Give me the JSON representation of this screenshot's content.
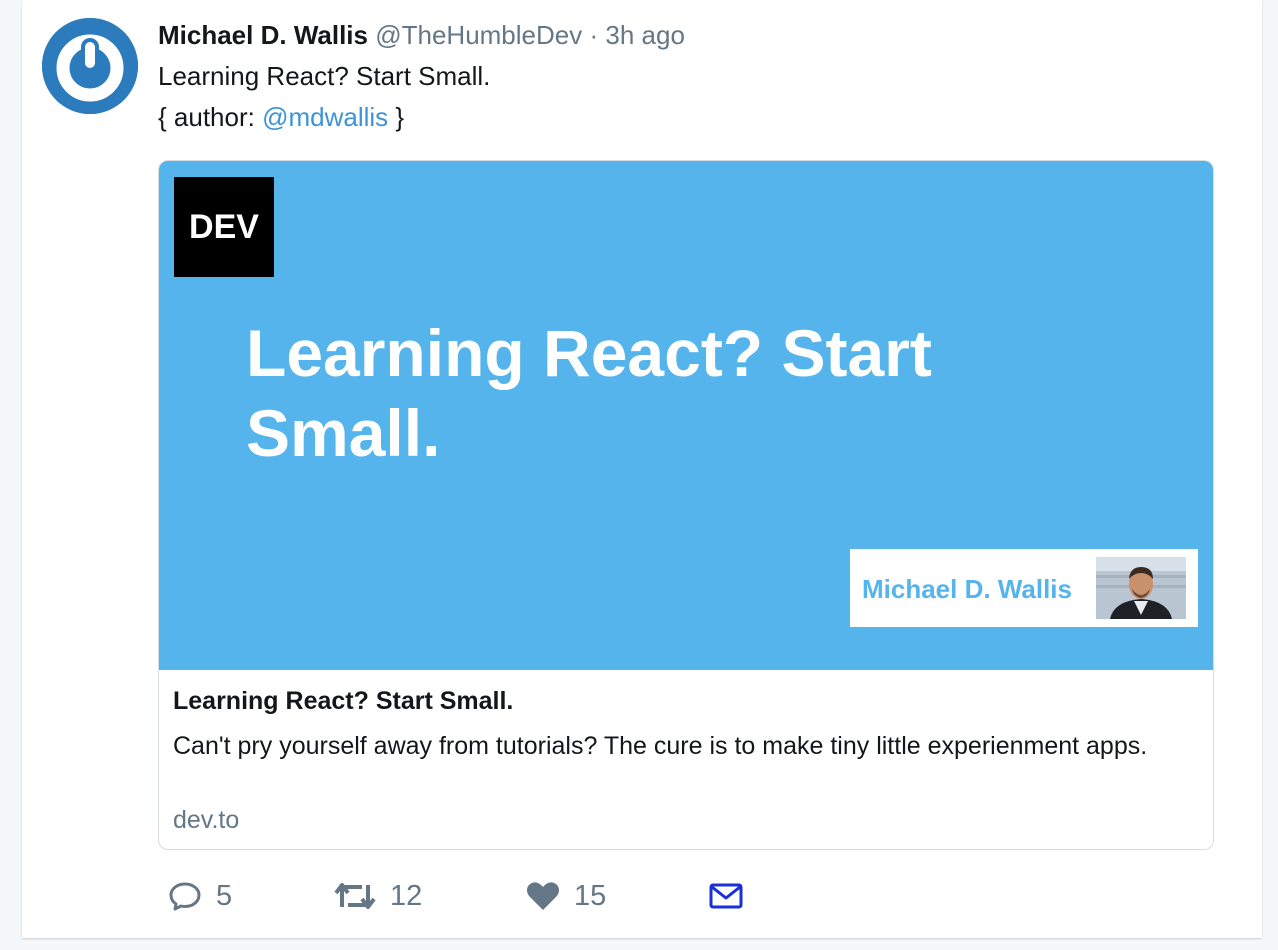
{
  "tweet": {
    "author_name": "Michael D. Wallis",
    "handle": "@TheHumbleDev",
    "separator": "·",
    "time": "3h ago",
    "text_line1": "Learning React? Start Small.",
    "text_line2_prefix": "{ author: ",
    "mention": "@mdwallis",
    "text_line2_suffix": " }"
  },
  "card": {
    "image": {
      "logo_text": "DEV",
      "headline": "Learning React? Start Small.",
      "author_name": "Michael D. Wallis",
      "background_color": "#56b4ec"
    },
    "title": "Learning React? Start Small.",
    "description": "Can't pry yourself away from tutorials? The cure is to make tiny little experienment apps.",
    "domain": "dev.to"
  },
  "actions": {
    "reply": {
      "icon": "reply-icon",
      "count": "5"
    },
    "retweet": {
      "icon": "retweet-icon",
      "count": "12"
    },
    "like": {
      "icon": "heart-icon",
      "count": "15"
    },
    "dm": {
      "icon": "envelope-icon",
      "color": "#1b2fd6"
    }
  },
  "colors": {
    "accent": "#3b94d9",
    "secondary_text": "#657786",
    "avatar_bg": "#2b7bbd"
  }
}
